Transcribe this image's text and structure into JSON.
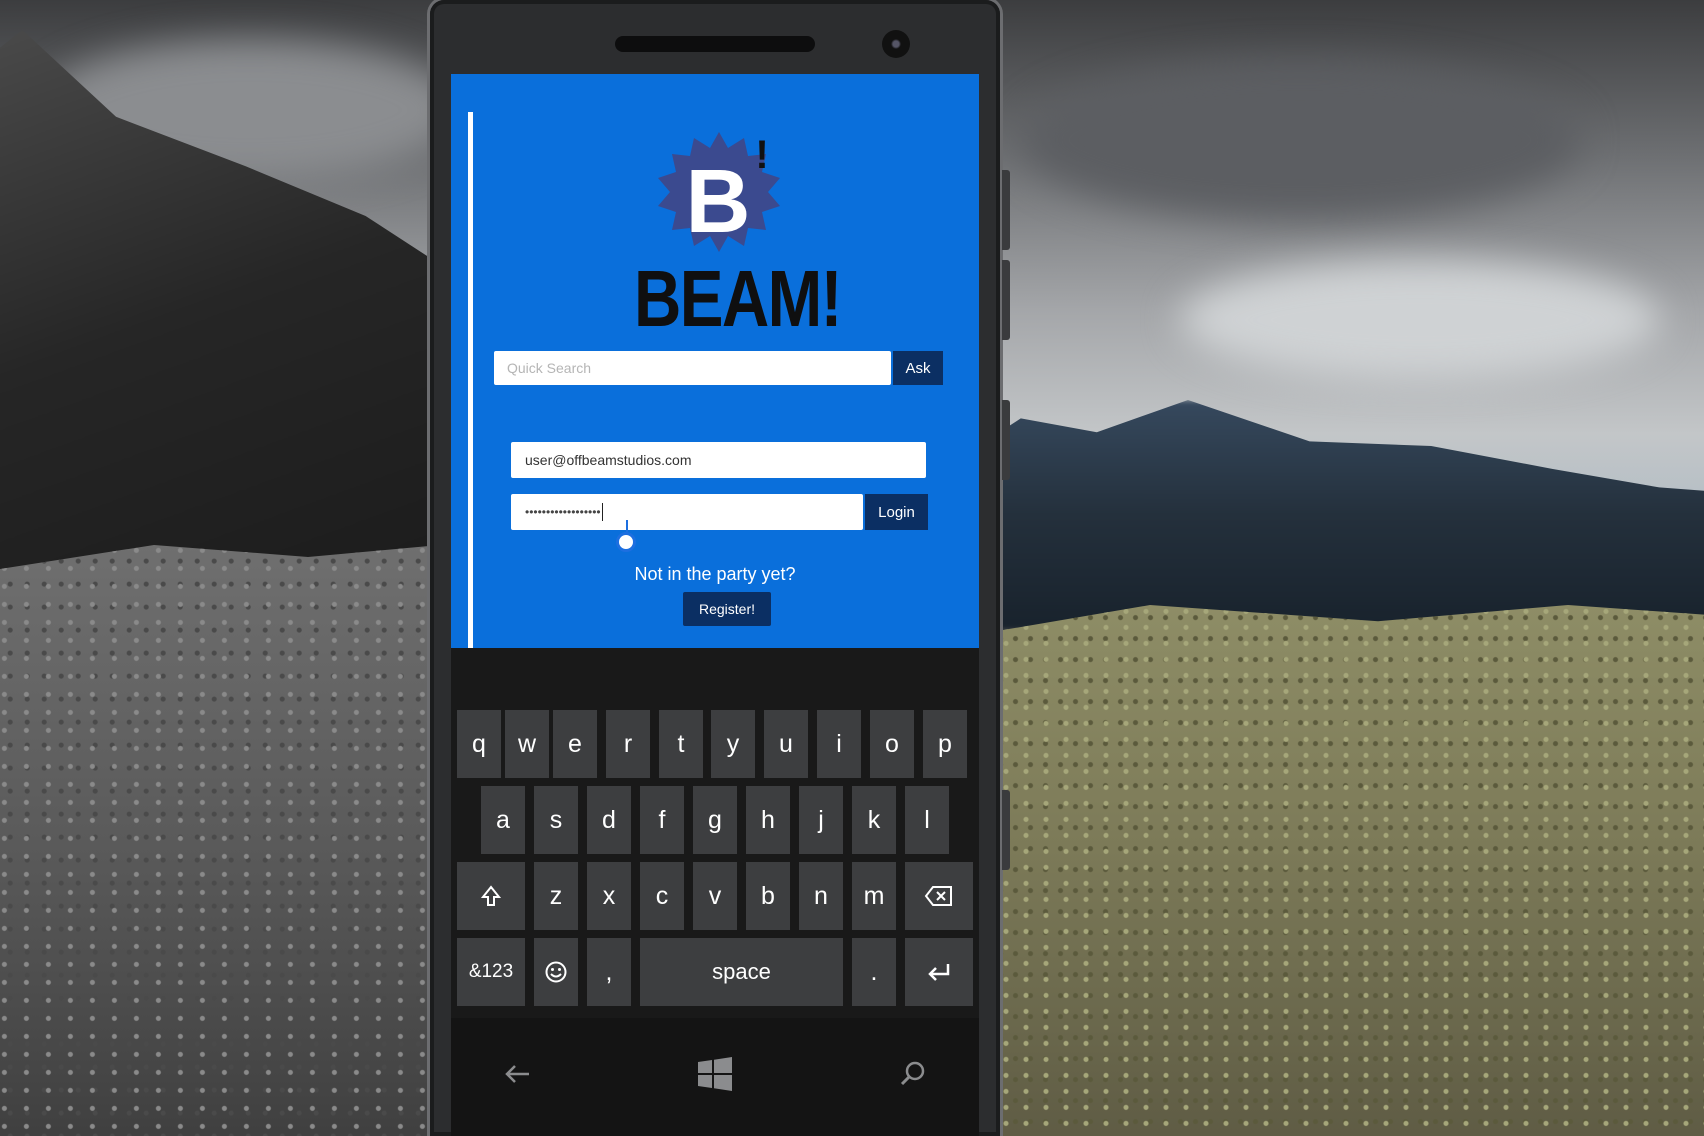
{
  "app": {
    "brand": "BEAM!",
    "logo_letter": "B",
    "logo_exclaim": "!",
    "search": {
      "placeholder": "Quick Search",
      "ask_label": "Ask"
    },
    "login": {
      "email_value": "user@offbeamstudios.com",
      "password_mask": "••••••••••••••••••",
      "login_label": "Login"
    },
    "register": {
      "prompt": "Not in the party yet?",
      "button_label": "Register!"
    }
  },
  "keyboard": {
    "row1": [
      "q",
      "w",
      "e",
      "r",
      "t",
      "y",
      "u",
      "i",
      "o",
      "p"
    ],
    "row2": [
      "a",
      "s",
      "d",
      "f",
      "g",
      "h",
      "j",
      "k",
      "l"
    ],
    "row3": [
      "z",
      "x",
      "c",
      "v",
      "b",
      "n",
      "m"
    ],
    "symbols_label": "&123",
    "comma": ",",
    "space_label": "space",
    "period": "."
  },
  "colors": {
    "app_blue": "#0a6fdb",
    "button_navy": "#0b2f63",
    "key_gray": "#3d3e40",
    "logo_badge": "#3b4a8f"
  },
  "icons": [
    "shift-icon",
    "backspace-icon",
    "emoji-icon",
    "enter-icon",
    "back-arrow-icon",
    "windows-logo-icon",
    "search-icon"
  ]
}
